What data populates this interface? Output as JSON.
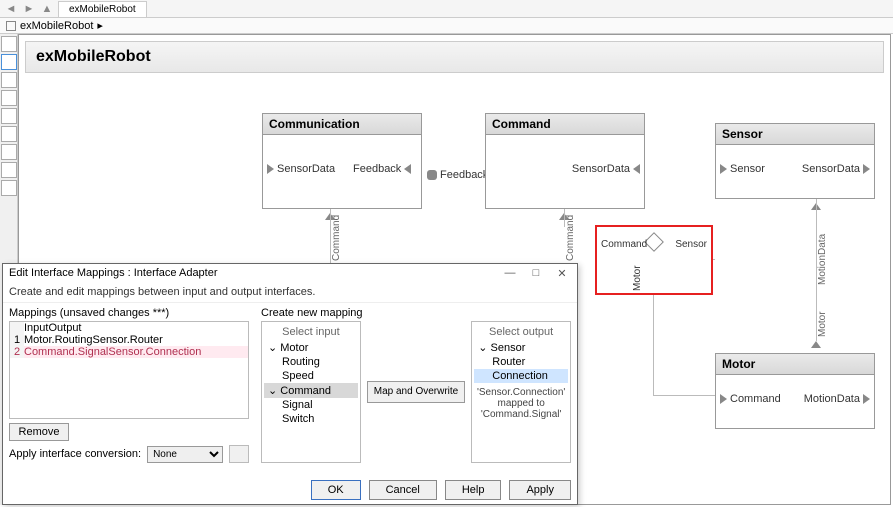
{
  "tabs": {
    "active": "exMobileRobot"
  },
  "breadcrumb": {
    "item": "exMobileRobot"
  },
  "canvas": {
    "title": "exMobileRobot"
  },
  "blocks": {
    "communication": {
      "title": "Communication",
      "ports": {
        "p1": "SensorData",
        "p2": "Feedback",
        "out": "Feedback",
        "bottom": "Command"
      }
    },
    "command": {
      "title": "Command",
      "ports": {
        "right": "SensorData",
        "bottom": "Command"
      }
    },
    "sensor": {
      "title": "Sensor",
      "ports": {
        "left": "Sensor",
        "right": "SensorData",
        "bottom": "MotionData"
      }
    },
    "motor": {
      "title": "Motor",
      "ports": {
        "left": "Command",
        "right": "MotionData",
        "top": "Motor"
      }
    }
  },
  "junction": {
    "left": "Command",
    "right": "Sensor",
    "bottom": "Motor"
  },
  "dialog": {
    "title": "Edit Interface Mappings : Interface Adapter",
    "desc": "Create and edit mappings between input and output interfaces.",
    "mappings_label": "Mappings (unsaved changes ***)",
    "create_label": "Create new mapping",
    "columns": {
      "input": "Input",
      "output": "Output"
    },
    "rows": [
      {
        "idx": "1",
        "in": "Motor.Routing",
        "out": "Sensor.Router"
      },
      {
        "idx": "2",
        "in": "Command.Signal",
        "out": "Sensor.Connection"
      }
    ],
    "remove": "Remove",
    "apply_conv": "Apply interface conversion:",
    "conv_value": "None",
    "select_input": "Select input",
    "select_output": "Select output",
    "tree_in": [
      {
        "l": 0,
        "t": "Motor",
        "exp": true
      },
      {
        "l": 1,
        "t": "Routing"
      },
      {
        "l": 1,
        "t": "Speed"
      },
      {
        "l": 0,
        "t": "Command",
        "exp": true,
        "sel": true
      },
      {
        "l": 1,
        "t": "Signal"
      },
      {
        "l": 1,
        "t": "Switch"
      }
    ],
    "tree_out": [
      {
        "l": 0,
        "t": "Sensor",
        "exp": true
      },
      {
        "l": 1,
        "t": "Router"
      },
      {
        "l": 1,
        "t": "Connection",
        "hl": true
      }
    ],
    "map_btn": "Map and Overwrite",
    "status": "'Sensor.Connection' mapped to 'Command.Signal'",
    "buttons": {
      "ok": "OK",
      "cancel": "Cancel",
      "help": "Help",
      "apply": "Apply"
    }
  }
}
